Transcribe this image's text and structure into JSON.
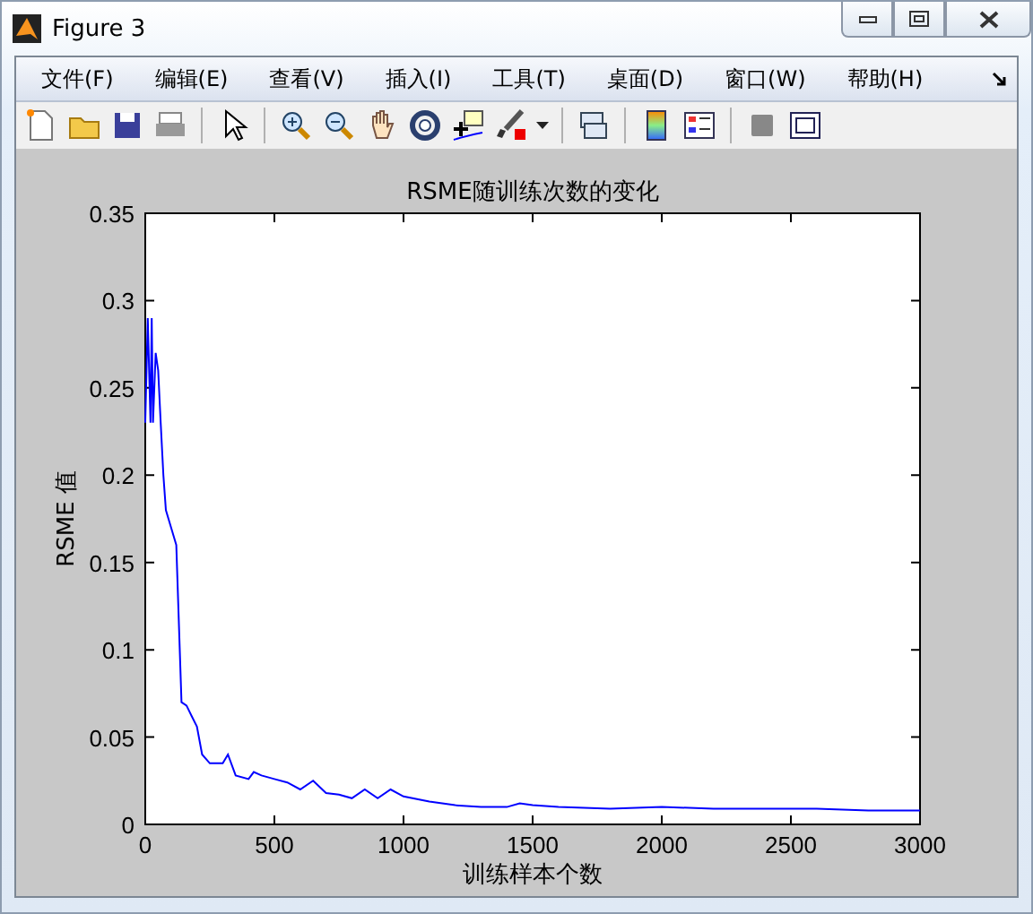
{
  "window": {
    "title": "Figure 3"
  },
  "menu": [
    {
      "label": "文件(F)"
    },
    {
      "label": "编辑(E)"
    },
    {
      "label": "查看(V)"
    },
    {
      "label": "插入(I)"
    },
    {
      "label": "工具(T)"
    },
    {
      "label": "桌面(D)"
    },
    {
      "label": "窗口(W)"
    },
    {
      "label": "帮助(H)"
    }
  ],
  "figure": {
    "chart_data": {
      "type": "line",
      "title": "RSME随训练次数的变化",
      "xlabel": "训练样本个数",
      "ylabel": "RSME 值",
      "xlim": [
        0,
        3000
      ],
      "ylim": [
        0,
        0.35
      ],
      "xticks": [
        0,
        500,
        1000,
        1500,
        2000,
        2500,
        3000
      ],
      "yticks": [
        {
          "value": 0,
          "label": "0"
        },
        {
          "value": 0.05,
          "label": "0.05"
        },
        {
          "value": 0.1,
          "label": "0.1"
        },
        {
          "value": 0.15,
          "label": "0.15"
        },
        {
          "value": 0.2,
          "label": "0.2"
        },
        {
          "value": 0.25,
          "label": "0.25"
        },
        {
          "value": 0.3,
          "label": "0.3"
        },
        {
          "value": 0.35,
          "label": "0.35"
        }
      ],
      "x": [
        0,
        10,
        20,
        25,
        30,
        40,
        50,
        60,
        70,
        80,
        100,
        120,
        140,
        160,
        180,
        200,
        220,
        250,
        300,
        320,
        350,
        400,
        420,
        450,
        500,
        550,
        600,
        650,
        700,
        750,
        800,
        850,
        900,
        950,
        1000,
        1100,
        1200,
        1300,
        1400,
        1450,
        1500,
        1600,
        1800,
        2000,
        2200,
        2400,
        2600,
        2800,
        3000
      ],
      "series": [
        {
          "color": "#0000ff",
          "values": [
            0.23,
            0.29,
            0.23,
            0.29,
            0.23,
            0.27,
            0.26,
            0.23,
            0.2,
            0.18,
            0.17,
            0.16,
            0.07,
            0.068,
            0.062,
            0.056,
            0.04,
            0.035,
            0.035,
            0.04,
            0.028,
            0.026,
            0.03,
            0.028,
            0.026,
            0.024,
            0.02,
            0.025,
            0.018,
            0.017,
            0.015,
            0.02,
            0.015,
            0.02,
            0.016,
            0.013,
            0.011,
            0.01,
            0.01,
            0.012,
            0.011,
            0.01,
            0.009,
            0.01,
            0.009,
            0.009,
            0.009,
            0.008,
            0.008
          ]
        }
      ]
    }
  }
}
